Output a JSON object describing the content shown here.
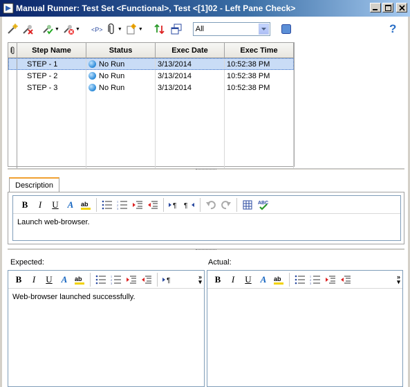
{
  "window": {
    "title": "Manual Runner: Test Set <Functional>, Test <[1]02 - Left Pane Check>",
    "buttons": [
      "minimize",
      "maximize",
      "close"
    ]
  },
  "toolbar": {
    "icons": [
      "new-run-icon",
      "end-run-icon",
      "pass-icon",
      "fail-icon",
      "parameters-icon",
      "attachments-icon",
      "defects-icon",
      "compact-view-icon",
      "window-icon"
    ],
    "filter_value": "All",
    "help": "?"
  },
  "grid": {
    "columns": [
      "Step Name",
      "Status",
      "Exec Date",
      "Exec Time"
    ],
    "rows": [
      {
        "step": "STEP - 1",
        "status": "No Run",
        "date": "3/13/2014",
        "time": "10:52:38 PM",
        "selected": true
      },
      {
        "step": "STEP - 2",
        "status": "No Run",
        "date": "3/13/2014",
        "time": "10:52:38 PM",
        "selected": false
      },
      {
        "step": "STEP - 3",
        "status": "No Run",
        "date": "3/13/2014",
        "time": "10:52:38 PM",
        "selected": false
      }
    ]
  },
  "description": {
    "tab_label": "Description",
    "text": "Launch web-browser."
  },
  "expected": {
    "label": "Expected:",
    "text": "Web-browser launched successfully."
  },
  "actual": {
    "label": "Actual:",
    "text": ""
  },
  "richtext": {
    "bold": "B",
    "italic": "I",
    "underline": "U",
    "color": "A",
    "more": "»"
  }
}
